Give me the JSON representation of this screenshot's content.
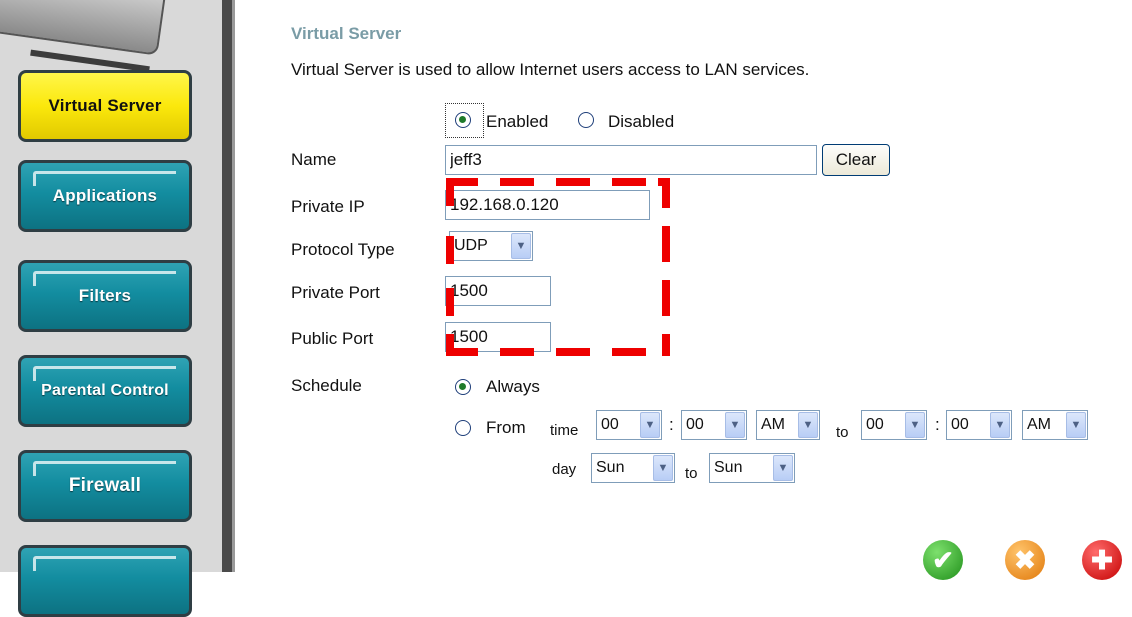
{
  "sidebar": {
    "items": [
      {
        "label": "Virtual Server",
        "active": true
      },
      {
        "label": "Applications",
        "active": false
      },
      {
        "label": "Filters",
        "active": false
      },
      {
        "label": "Parental Control",
        "active": false
      },
      {
        "label": "Firewall",
        "active": false
      }
    ]
  },
  "main": {
    "title": "Virtual Server",
    "description": "Virtual Server is used to allow Internet users access to LAN services.",
    "status": {
      "enabled_label": "Enabled",
      "disabled_label": "Disabled",
      "selected": "Enabled"
    },
    "name": {
      "label": "Name",
      "value": "jeff3",
      "clear_label": "Clear"
    },
    "private_ip": {
      "label": "Private IP",
      "value": "192.168.0.120"
    },
    "protocol": {
      "label": "Protocol Type",
      "value": "UDP"
    },
    "private_port": {
      "label": "Private Port",
      "value": "1500"
    },
    "public_port": {
      "label": "Public Port",
      "value": "1500"
    },
    "schedule": {
      "label": "Schedule",
      "always_label": "Always",
      "from_label": "From",
      "time_label": "time",
      "to_label": "to",
      "day_label": "day",
      "colon": ":",
      "selected": "Always",
      "start_hour": "00",
      "start_min": "00",
      "start_ampm": "AM",
      "end_hour": "00",
      "end_min": "00",
      "end_ampm": "AM",
      "start_day": "Sun",
      "end_day": "Sun"
    }
  },
  "colors": {
    "accent_teal": "#138da0",
    "active_yellow": "#fbe80c",
    "highlight_red": "#ee0000",
    "title": "#7a9ca6"
  },
  "icons": [
    "checkmark-icon",
    "cancel-icon",
    "help-icon",
    "chevron-down-icon"
  ]
}
